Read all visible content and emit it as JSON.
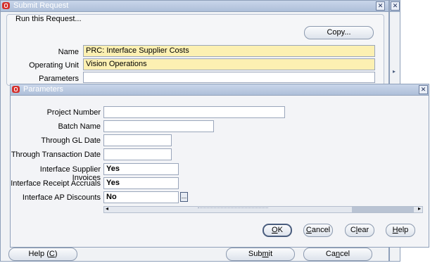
{
  "submit_window": {
    "title": "Submit Request",
    "section_title": "Run this Request...",
    "copy_button": "Copy...",
    "name_label": "Name",
    "name_value": "PRC: Interface Supplier Costs",
    "operating_unit_label": "Operating Unit",
    "operating_unit_value": "Vision Operations",
    "parameters_label": "Parameters",
    "help_button": {
      "pre": "Help (",
      "key": "C",
      "post": ")"
    },
    "submit_button": {
      "pre": "Sub",
      "key": "m",
      "post": "it"
    },
    "cancel_button": {
      "pre": "Ca",
      "key": "n",
      "post": "cel"
    }
  },
  "parameters_window": {
    "title": "Parameters",
    "fields": [
      {
        "label": "Project Number",
        "value": ""
      },
      {
        "label": "Batch Name",
        "value": ""
      },
      {
        "label": "Through GL Date",
        "value": ""
      },
      {
        "label": "Through Transaction Date",
        "value": ""
      },
      {
        "label": "Interface Supplier Invoices",
        "value": "Yes"
      },
      {
        "label": "Interface Receipt Accruals",
        "value": "Yes"
      },
      {
        "label": "Interface AP Discounts",
        "value": "No"
      }
    ],
    "lov_button": "...",
    "ok_button": {
      "pre": "",
      "key": "O",
      "post": "K"
    },
    "cancel_button": {
      "pre": "",
      "key": "C",
      "post": "ancel"
    },
    "clear_button": {
      "pre": "C",
      "key": "l",
      "post": "ear"
    },
    "help_button": {
      "pre": "",
      "key": "H",
      "post": "elp"
    }
  },
  "colors": {
    "titlebar": "#aebfd9",
    "required_field": "#fcf0b2",
    "oracle_icon": "#d4312d"
  }
}
